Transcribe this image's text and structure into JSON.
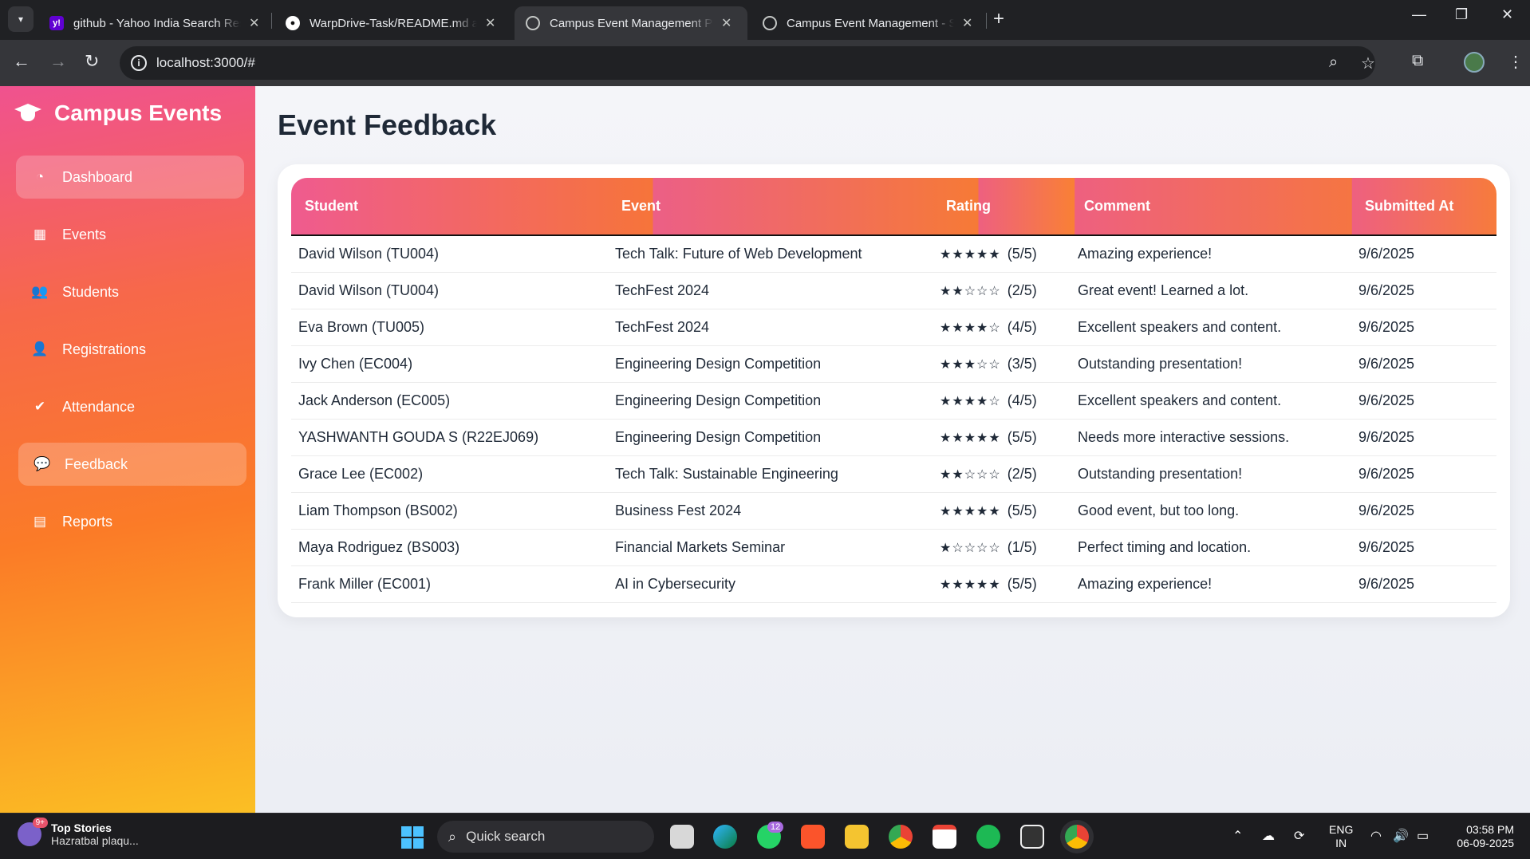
{
  "browser": {
    "tabs": [
      {
        "title": "github - Yahoo India Search Res",
        "favicon": "yahoo-icon",
        "active": false
      },
      {
        "title": "WarpDrive-Task/README.md at",
        "favicon": "github-icon",
        "active": false
      },
      {
        "title": "Campus Event Management Pla",
        "favicon": "globe-icon",
        "active": true
      },
      {
        "title": "Campus Event Management - S",
        "favicon": "globe-icon",
        "active": false
      }
    ],
    "url": "localhost:3000/#"
  },
  "app": {
    "brand": "Campus Events",
    "nav": [
      {
        "label": "Dashboard",
        "icon": "dashboard-icon"
      },
      {
        "label": "Events",
        "icon": "calendar-icon"
      },
      {
        "label": "Students",
        "icon": "users-icon"
      },
      {
        "label": "Registrations",
        "icon": "user-plus-icon"
      },
      {
        "label": "Attendance",
        "icon": "check-circle-icon"
      },
      {
        "label": "Feedback",
        "icon": "comments-icon"
      },
      {
        "label": "Reports",
        "icon": "chart-icon"
      }
    ],
    "active_nav": "Feedback",
    "page_title": "Event Feedback",
    "table": {
      "headers": [
        "Student",
        "Event",
        "Rating",
        "Comment",
        "Submitted At"
      ],
      "rows": [
        {
          "student": "David Wilson (TU004)",
          "event": "Tech Talk: Future of Web Development",
          "stars": "★★★★★",
          "rating": "(5/5)",
          "comment": "Amazing experience!",
          "submitted": "9/6/2025"
        },
        {
          "student": "David Wilson (TU004)",
          "event": "TechFest 2024",
          "stars": "★★☆☆☆",
          "rating": "(2/5)",
          "comment": "Great event! Learned a lot.",
          "submitted": "9/6/2025"
        },
        {
          "student": "Eva Brown (TU005)",
          "event": "TechFest 2024",
          "stars": "★★★★☆",
          "rating": "(4/5)",
          "comment": "Excellent speakers and content.",
          "submitted": "9/6/2025"
        },
        {
          "student": "Ivy Chen (EC004)",
          "event": "Engineering Design Competition",
          "stars": "★★★☆☆",
          "rating": "(3/5)",
          "comment": "Outstanding presentation!",
          "submitted": "9/6/2025"
        },
        {
          "student": "Jack Anderson (EC005)",
          "event": "Engineering Design Competition",
          "stars": "★★★★☆",
          "rating": "(4/5)",
          "comment": "Excellent speakers and content.",
          "submitted": "9/6/2025"
        },
        {
          "student": "YASHWANTH GOUDA S (R22EJ069)",
          "event": "Engineering Design Competition",
          "stars": "★★★★★",
          "rating": "(5/5)",
          "comment": "Needs more interactive sessions.",
          "submitted": "9/6/2025"
        },
        {
          "student": "Grace Lee (EC002)",
          "event": "Tech Talk: Sustainable Engineering",
          "stars": "★★☆☆☆",
          "rating": "(2/5)",
          "comment": "Outstanding presentation!",
          "submitted": "9/6/2025"
        },
        {
          "student": "Liam Thompson (BS002)",
          "event": "Business Fest 2024",
          "stars": "★★★★★",
          "rating": "(5/5)",
          "comment": "Good event, but too long.",
          "submitted": "9/6/2025"
        },
        {
          "student": "Maya Rodriguez (BS003)",
          "event": "Financial Markets Seminar",
          "stars": "★☆☆☆☆",
          "rating": "(1/5)",
          "comment": "Perfect timing and location.",
          "submitted": "9/6/2025"
        },
        {
          "student": "Frank Miller (EC001)",
          "event": "AI in Cybersecurity",
          "stars": "★★★★★",
          "rating": "(5/5)",
          "comment": "Amazing experience!",
          "submitted": "9/6/2025"
        }
      ]
    }
  },
  "taskbar": {
    "news_badge": "9+",
    "news_title": "Top Stories",
    "news_sub": "Hazratbal plaqu...",
    "search_placeholder": "Quick search",
    "whatsapp_badge": "12",
    "lang_top": "ENG",
    "lang_bottom": "IN",
    "time": "03:58 PM",
    "date": "06-09-2025"
  },
  "colors": {
    "sidebar_top": "#f0528f",
    "sidebar_bottom": "#fbbf24",
    "header_pink": "#ef5b8f",
    "header_orange": "#f67a36"
  }
}
